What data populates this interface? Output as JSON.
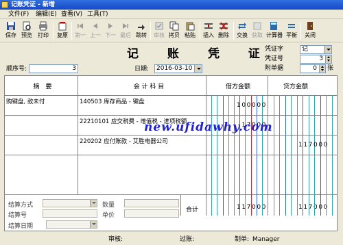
{
  "window": {
    "title": "记账凭证 - 新增"
  },
  "menu": [
    "文件(F)",
    "编辑(E)",
    "查看(V)",
    "工具(T)"
  ],
  "toolbar": {
    "save": "保存",
    "preview": "预览",
    "print": "打印",
    "restore": "复原",
    "first": "第一",
    "prev": "上一",
    "next": "下一",
    "last": "最后",
    "jump": "跳转",
    "audit": "审核",
    "copy": "拷贝",
    "paste": "粘贴",
    "insert": "插入",
    "delete": "删除",
    "exchange": "交换",
    "fetch": "获取",
    "calculator": "计算器",
    "balance": "平衡",
    "close": "关闭"
  },
  "voucher": {
    "title": "记 账 凭 证",
    "seq_label": "顺序号:",
    "seq_value": "3",
    "date_label": "日期:",
    "date_value": "2016-03-10",
    "type_label": "凭证字",
    "type_value": "记",
    "no_label": "凭证号",
    "no_value": "3",
    "attach_label": "附单据",
    "attach_value": "0",
    "attach_unit": "张"
  },
  "grid": {
    "headers": {
      "summary": "摘　要",
      "account": "会 计 科 目",
      "debit": "借方金额",
      "credit": "贷方金额"
    },
    "rows": [
      {
        "summary": "购键盘, 款未付",
        "account": "140503 库存商品 - 键盘",
        "debit": "100000",
        "credit": ""
      },
      {
        "summary": "",
        "account": "22210101 应交税费 - 增值税 - 进项税额",
        "debit": "17000",
        "credit": ""
      },
      {
        "summary": "",
        "account": "220202 应付账款 - 艾胜电器公司",
        "debit": "",
        "credit": "117000"
      },
      {
        "summary": "",
        "account": "",
        "debit": "",
        "credit": ""
      }
    ]
  },
  "settlement": {
    "method_label": "结算方式",
    "qty_label": "数量",
    "no_label": "结算号",
    "price_label": "单价",
    "date_label": "结算日期",
    "total_label": "合计",
    "total_debit": "117000",
    "total_credit": "117000"
  },
  "footer": {
    "audit_label": "审核:",
    "post_label": "过账:",
    "maker_label": "制单:",
    "maker_value": "Manager"
  },
  "watermark": "new.ufidawhy.com",
  "colors": {
    "title_bar": "#1549c8",
    "grid_red": "#e02020",
    "grid_blue": "#3060c8",
    "grid_teal": "#30a8a8",
    "watermark": "#2222cc"
  }
}
